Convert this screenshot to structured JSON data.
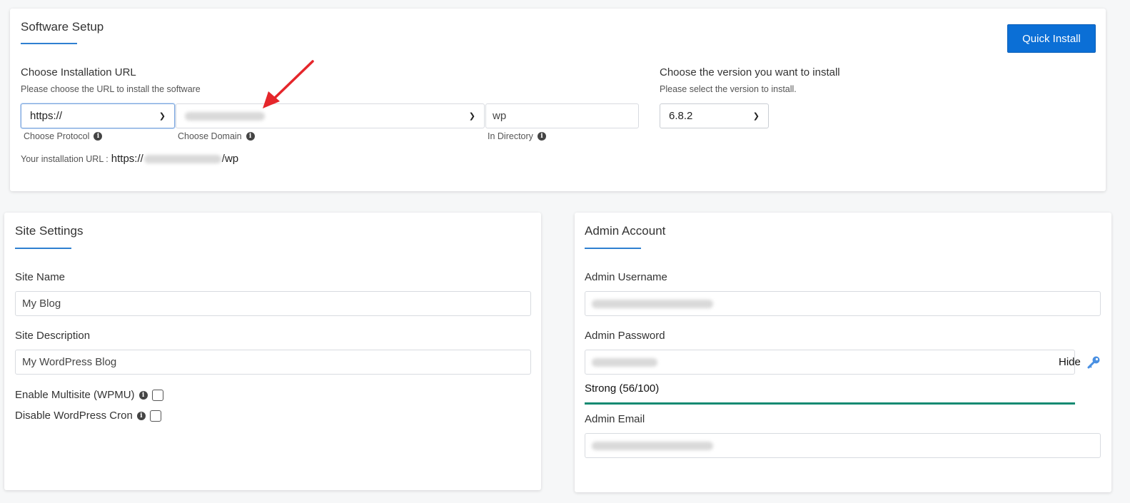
{
  "setup": {
    "title": "Software Setup",
    "quick_install_label": "Quick Install",
    "url_section": {
      "label": "Choose Installation URL",
      "sublabel": "Please choose the URL to install the software",
      "protocol_value": "https://",
      "protocol_hint": "Choose Protocol",
      "domain_hint": "Choose Domain",
      "directory_value": "wp",
      "directory_hint": "In Directory",
      "install_url_prefix_label": "Your installation URL :",
      "install_url_scheme": "https://",
      "install_url_suffix": "/wp"
    },
    "version_section": {
      "label": "Choose the version you want to install",
      "sublabel": "Please select the version to install.",
      "version_value": "6.8.2"
    }
  },
  "site": {
    "title": "Site Settings",
    "name_label": "Site Name",
    "name_value": "My Blog",
    "description_label": "Site Description",
    "description_value": "My WordPress Blog",
    "multisite_label": "Enable Multisite (WPMU)",
    "cron_label": "Disable WordPress Cron"
  },
  "admin": {
    "title": "Admin Account",
    "username_label": "Admin Username",
    "password_label": "Admin Password",
    "hide_label": "Hide",
    "strength_text": "Strong (56/100)",
    "email_label": "Admin Email"
  },
  "colors": {
    "accent": "#2f80d1",
    "button": "#0b6fd6",
    "strength": "#138a72",
    "arrow": "#e5262b"
  }
}
